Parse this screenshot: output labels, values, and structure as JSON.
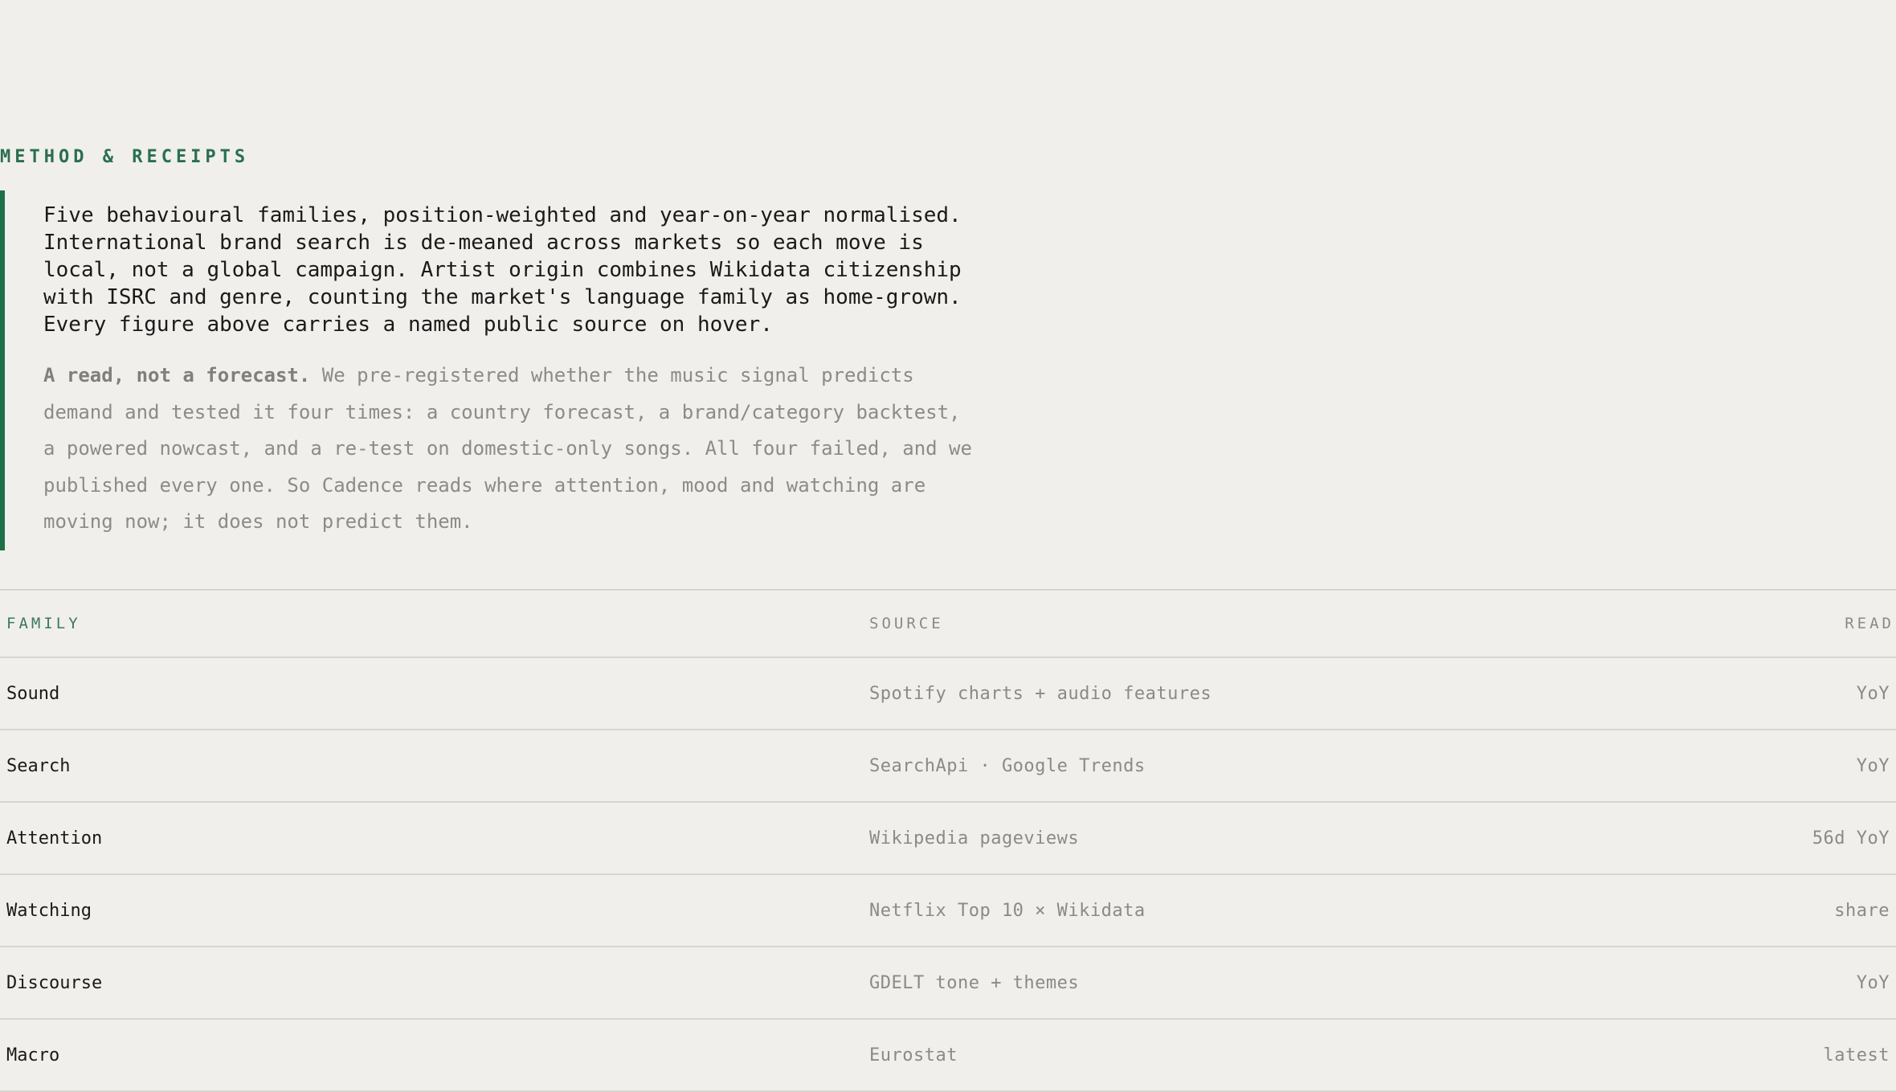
{
  "section": {
    "label": "METHOD & RECEIPTS"
  },
  "callout": {
    "lead": "Five behavioural families, position-weighted and year-on-year normalised.\nInternational brand search is de-meaned across markets so each move is\nlocal, not a global campaign. Artist origin combines Wikidata citizenship\nwith ISRC and genre, counting the market's language family as home-grown.\nEvery figure above carries a named public source on hover.",
    "note_strong": "A read, not a forecast.",
    "note_body": " We pre-registered whether the music signal predicts\ndemand and tested it four times: a country forecast, a brand/category backtest,\na powered nowcast, and a re-test on domestic-only songs. All four failed, and we\npublished every one. So Cadence reads where attention, mood and watching are\nmoving now; it does not predict them."
  },
  "table": {
    "headers": {
      "family": "FAMILY",
      "source": "SOURCE",
      "read": "READ"
    },
    "rows": [
      {
        "family": "Sound",
        "source": "Spotify charts + audio features",
        "read": "YoY"
      },
      {
        "family": "Search",
        "source": "SearchApi · Google Trends",
        "read": "YoY"
      },
      {
        "family": "Attention",
        "source": "Wikipedia pageviews",
        "read": "56d YoY"
      },
      {
        "family": "Watching",
        "source": "Netflix Top 10 × Wikidata",
        "read": "share"
      },
      {
        "family": "Discourse",
        "source": "GDELT tone + themes",
        "read": "YoY"
      },
      {
        "family": "Macro",
        "source": "Eurostat",
        "read": "latest"
      }
    ]
  },
  "colors": {
    "accent": "#1d7047",
    "background": "#f0efeb",
    "muted_text": "#8a8a86",
    "rule": "#d6d5d0"
  }
}
